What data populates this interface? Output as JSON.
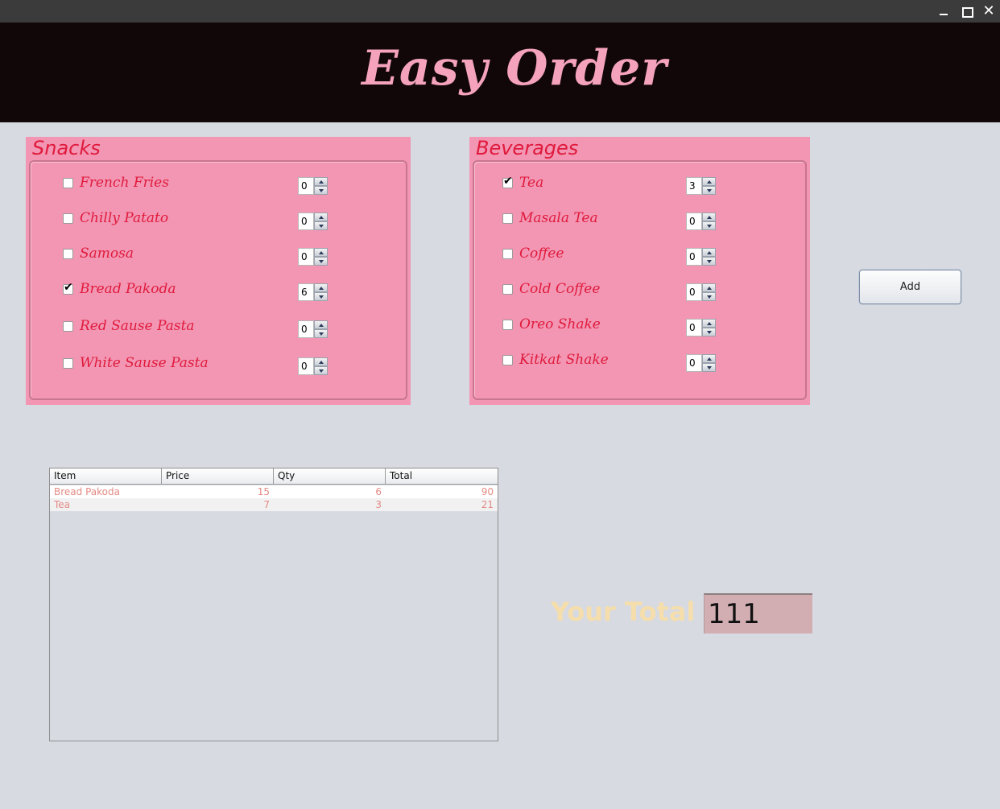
{
  "window": {
    "minimize_icon": "minimize-icon",
    "maximize_icon": "maximize-icon",
    "close_icon": "close-icon",
    "close_glyph": "✕"
  },
  "header": {
    "title": "Easy Order",
    "bg_color": "#120708",
    "title_color": "#f5a3bc"
  },
  "snacks": {
    "title": "Snacks",
    "items": [
      {
        "label": "French Fries",
        "checked": false,
        "qty": "0"
      },
      {
        "label": "Chilly Patato",
        "checked": false,
        "qty": "0"
      },
      {
        "label": "Samosa",
        "checked": false,
        "qty": "0"
      },
      {
        "label": "Bread Pakoda",
        "checked": true,
        "qty": "6"
      },
      {
        "label": "Red Sause Pasta",
        "checked": false,
        "qty": "0"
      },
      {
        "label": "White Sause Pasta",
        "checked": false,
        "qty": "0"
      }
    ]
  },
  "beverages": {
    "title": "Beverages",
    "items": [
      {
        "label": "Tea",
        "checked": true,
        "qty": "3"
      },
      {
        "label": "Masala Tea",
        "checked": false,
        "qty": "0"
      },
      {
        "label": "Coffee",
        "checked": false,
        "qty": "0"
      },
      {
        "label": "Cold Coffee",
        "checked": false,
        "qty": "0"
      },
      {
        "label": "Oreo Shake",
        "checked": false,
        "qty": "0"
      },
      {
        "label": "Kitkat Shake",
        "checked": false,
        "qty": "0"
      }
    ]
  },
  "add_button": {
    "label": "Add"
  },
  "order_table": {
    "columns": [
      "Item",
      "Price",
      "Qty",
      "Total"
    ],
    "rows": [
      {
        "item": "Bread Pakoda",
        "price": "15",
        "qty": "6",
        "total": "90"
      },
      {
        "item": "Tea",
        "price": "7",
        "qty": "3",
        "total": "21"
      }
    ]
  },
  "total": {
    "label": "Your Total",
    "value": "111"
  },
  "colors": {
    "panel": "#f296b3",
    "item_text": "#e01a3c",
    "total_label": "#f5deab",
    "table_text": "#e48a84",
    "background": "#d7dae1"
  }
}
